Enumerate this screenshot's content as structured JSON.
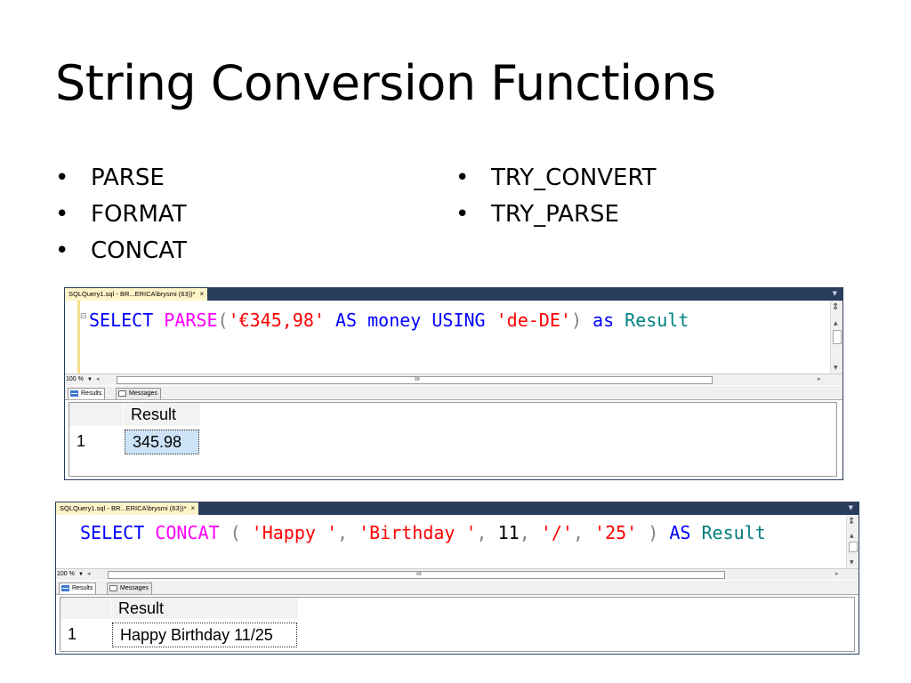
{
  "slide": {
    "title": "String Conversion Functions",
    "bullet_glyph": "•",
    "bullets_left": [
      "PARSE",
      "FORMAT",
      "CONCAT"
    ],
    "bullets_right": [
      "TRY_CONVERT",
      "TRY_PARSE"
    ]
  },
  "window1": {
    "tab_title": "SQLQuery1.sql - BR...ERICA\\brysmi (63))*",
    "tab_close": "×",
    "collapse_marker": "⊟",
    "code_tokens": [
      {
        "text": "SELECT",
        "cls": "kw"
      },
      {
        "text": " ",
        "cls": ""
      },
      {
        "text": "PARSE",
        "cls": "fn"
      },
      {
        "text": "(",
        "cls": "gray"
      },
      {
        "text": "'€345,98'",
        "cls": "str"
      },
      {
        "text": " ",
        "cls": ""
      },
      {
        "text": "AS",
        "cls": "kw"
      },
      {
        "text": " money ",
        "cls": "kw"
      },
      {
        "text": "USING",
        "cls": "kw"
      },
      {
        "text": " ",
        "cls": ""
      },
      {
        "text": "'de-DE'",
        "cls": "str"
      },
      {
        "text": ")",
        "cls": "gray"
      },
      {
        "text": " ",
        "cls": ""
      },
      {
        "text": "as",
        "cls": "kw"
      },
      {
        "text": " ",
        "cls": ""
      },
      {
        "text": "Result",
        "cls": "teal"
      }
    ],
    "zoom": "100 %",
    "results_tab": "Results",
    "messages_tab": "Messages",
    "column_header": "Result",
    "row_number": "1",
    "cell_value": "345.98"
  },
  "window2": {
    "tab_title": "SQLQuery1.sql - BR...ERICA\\brysmi (63))*",
    "tab_close": "×",
    "code_tokens": [
      {
        "text": "SELECT",
        "cls": "kw"
      },
      {
        "text": " ",
        "cls": ""
      },
      {
        "text": "CONCAT",
        "cls": "fn"
      },
      {
        "text": " ( ",
        "cls": "gray"
      },
      {
        "text": "'Happy '",
        "cls": "str"
      },
      {
        "text": ", ",
        "cls": "gray"
      },
      {
        "text": "'Birthday '",
        "cls": "str"
      },
      {
        "text": ", ",
        "cls": "gray"
      },
      {
        "text": "11",
        "cls": "num"
      },
      {
        "text": ", ",
        "cls": "gray"
      },
      {
        "text": "'/'",
        "cls": "str"
      },
      {
        "text": ", ",
        "cls": "gray"
      },
      {
        "text": "'25'",
        "cls": "str"
      },
      {
        "text": " ) ",
        "cls": "gray"
      },
      {
        "text": "AS",
        "cls": "kw"
      },
      {
        "text": " ",
        "cls": ""
      },
      {
        "text": "Result",
        "cls": "teal"
      }
    ],
    "zoom": "100 %",
    "results_tab": "Results",
    "messages_tab": "Messages",
    "column_header": "Result",
    "row_number": "1",
    "cell_value": "Happy Birthday 11/25"
  },
  "colors": {
    "keyword": "#0000ff",
    "function": "#ff00ff",
    "string": "#ff0000",
    "operator": "#808080",
    "identifier": "#008080",
    "tab_bar": "#2b3d5c",
    "tab_active": "#fff4c8",
    "selected_cell": "#cde3f7"
  },
  "icons": {
    "results_tab_icon": "grid-icon",
    "messages_tab_icon": "message-icon",
    "splitter_icon": "splitter-icon",
    "zoom_dropdown_icon": "chevron-down-icon"
  }
}
